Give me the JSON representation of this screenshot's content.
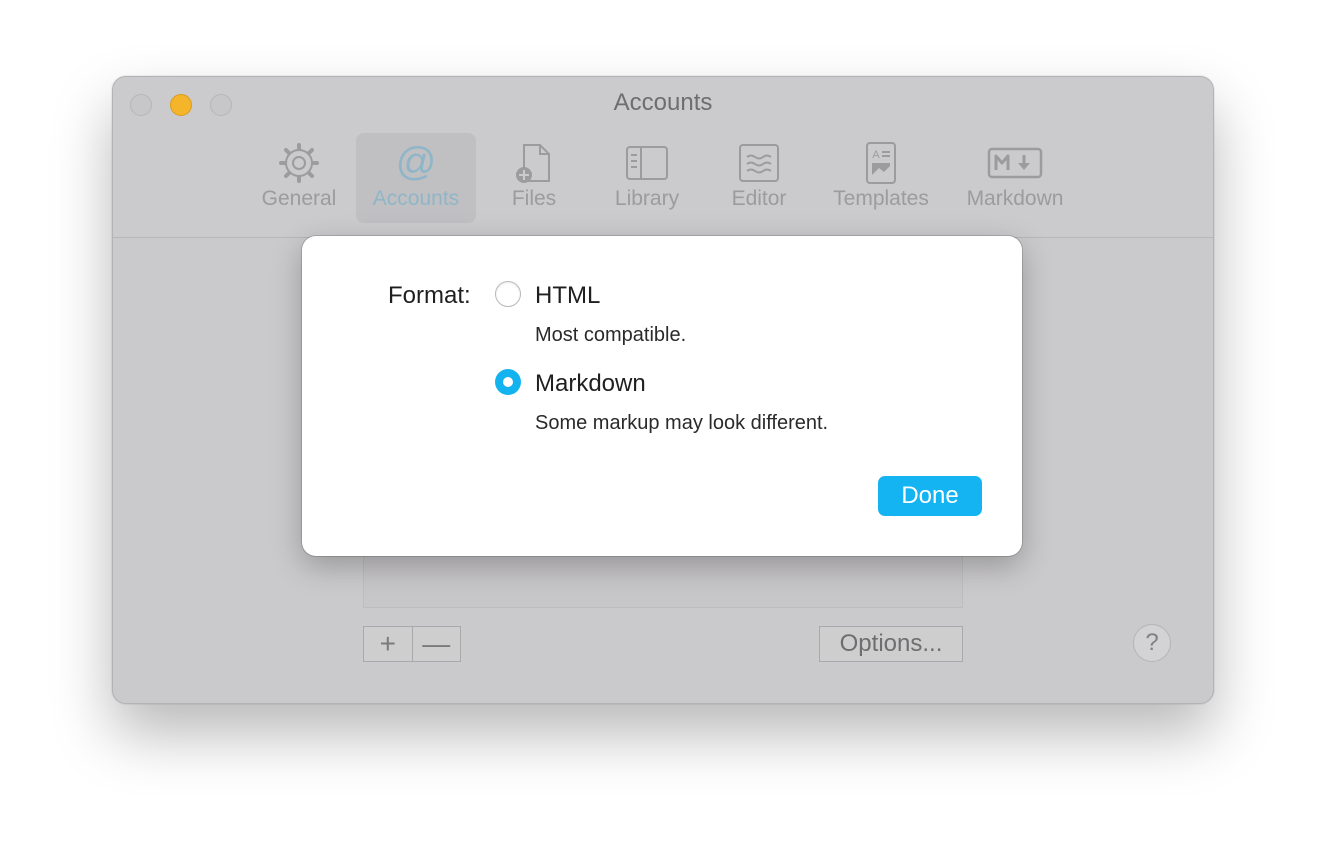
{
  "window": {
    "title": "Accounts"
  },
  "toolbar": {
    "items": [
      {
        "label": "General",
        "icon": "gear-icon"
      },
      {
        "label": "Accounts",
        "icon": "at-icon"
      },
      {
        "label": "Files",
        "icon": "file-add-icon"
      },
      {
        "label": "Library",
        "icon": "library-icon"
      },
      {
        "label": "Editor",
        "icon": "editor-icon"
      },
      {
        "label": "Templates",
        "icon": "templates-icon"
      },
      {
        "label": "Markdown",
        "icon": "markdown-icon"
      }
    ],
    "selected": "Accounts"
  },
  "content": {
    "add_label": "+",
    "remove_label": "—",
    "options_label": "Options...",
    "help_label": "?"
  },
  "sheet": {
    "format_label": "Format:",
    "options": [
      {
        "label": "HTML",
        "description": "Most compatible.",
        "selected": false
      },
      {
        "label": "Markdown",
        "description": "Some markup may look different.",
        "selected": true
      }
    ],
    "done_label": "Done"
  },
  "colors": {
    "accent": "#14b3f1",
    "minimize": "#f5b52a"
  }
}
